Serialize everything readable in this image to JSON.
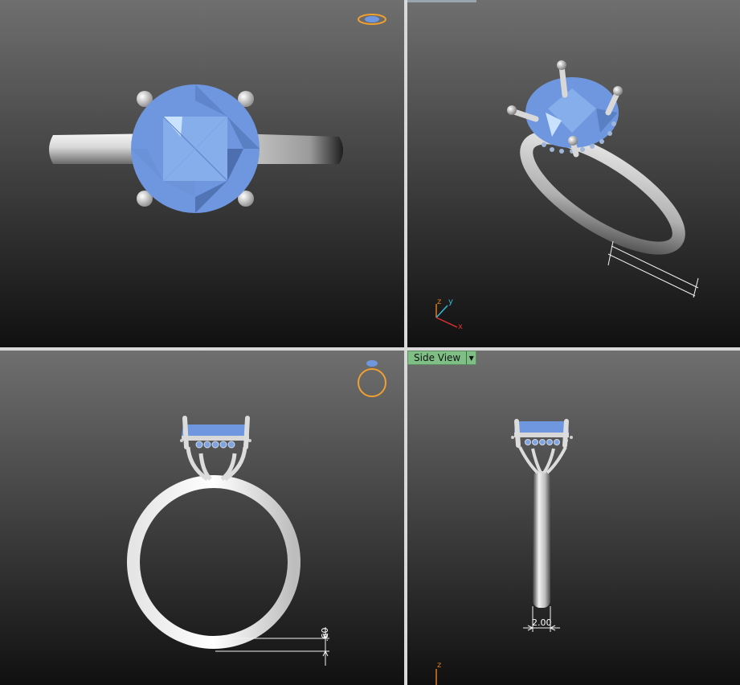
{
  "viewports": {
    "side": {
      "label": "Side View"
    }
  },
  "dimensions": {
    "band_thickness": ".60",
    "band_width": "2.00"
  },
  "axes": {
    "persp": {
      "z": "z",
      "y": "y",
      "x": "x"
    },
    "side": {
      "z": "z"
    }
  },
  "colors": {
    "gem": "#6f97df",
    "metal": "#e8e8e8",
    "gizmo": "#f0a030",
    "label_bg": "#7fbf86"
  }
}
